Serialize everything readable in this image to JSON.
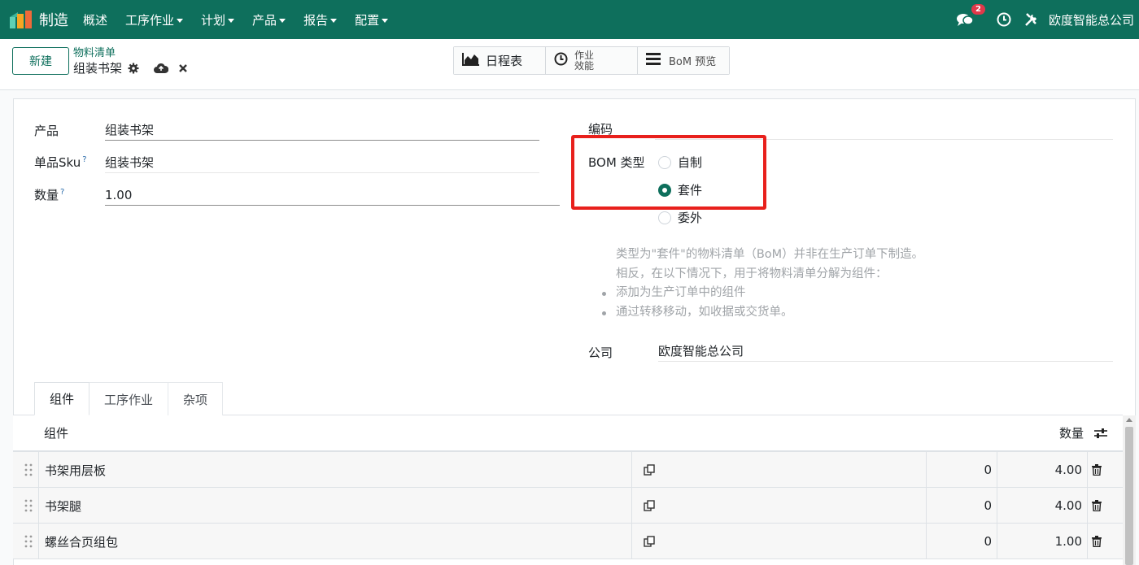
{
  "navbar": {
    "app_name": "制造",
    "menu": [
      "概述",
      "工序作业",
      "计划",
      "产品",
      "报告",
      "配置"
    ],
    "menu_dropdown": [
      false,
      true,
      true,
      true,
      true,
      true
    ],
    "message_count": "2",
    "company": "欧度智能总公司",
    "brand_color": "#0e6f5c"
  },
  "control": {
    "new_button": "新建",
    "breadcrumb_parent": "物料清单",
    "breadcrumb_current": "组装书架",
    "stat_schedule": "日程表",
    "stat_efficiency_line1": "作业",
    "stat_efficiency_line2": "效能",
    "stat_bom_preview": "BoM 预览"
  },
  "form": {
    "product_label": "产品",
    "product_value": "组装书架",
    "sku_label": "单品Sku",
    "sku_value": "组装书架",
    "qty_label": "数量",
    "qty_value": "1.00",
    "help_mark": "?",
    "code_label": "编码",
    "bom_type_label": "BOM 类型",
    "bom_type_options": [
      "自制",
      "套件",
      "委外"
    ],
    "bom_type_selected": "套件",
    "help_lines": [
      "类型为\"套件\"的物料清单（BoM）并非在生产订单下制造。",
      "相反，在以下情况下，用于将物料清单分解为组件："
    ],
    "help_bullets": [
      "添加为生产订单中的组件",
      "通过转移移动，如收据或交货单。"
    ],
    "company_label": "公司",
    "company_value": "欧度智能总公司",
    "highlight_color": "#e8201c"
  },
  "tabs": [
    "组件",
    "工序作业",
    "杂项"
  ],
  "table": {
    "col_component": "组件",
    "col_qty": "数量",
    "rows": [
      {
        "name": "书架用层板",
        "num": "0",
        "qty": "4.00"
      },
      {
        "name": "书架腿",
        "num": "0",
        "qty": "4.00"
      },
      {
        "name": "螺丝合页组包",
        "num": "0",
        "qty": "1.00"
      }
    ]
  }
}
